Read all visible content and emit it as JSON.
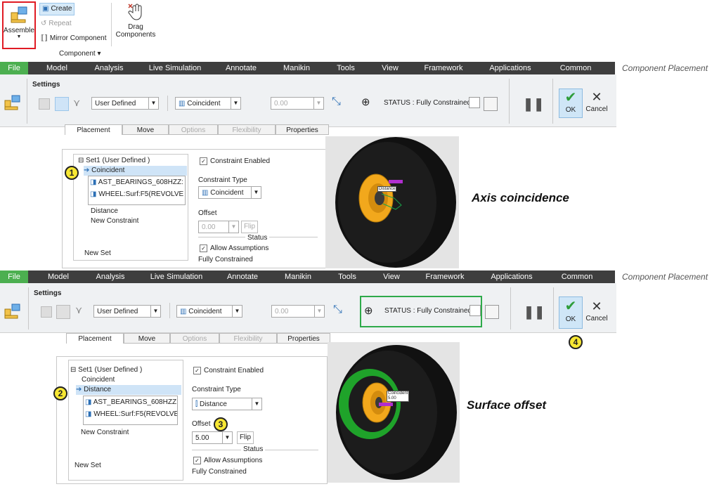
{
  "ribbon": {
    "assemble_label": "Assemble",
    "create_label": "Create",
    "repeat_label": "Repeat",
    "mirror_label": "Mirror Component",
    "drag_label_1": "Drag",
    "drag_label_2": "Components",
    "group_label": "Component ▾"
  },
  "menu": {
    "file": "File",
    "items": [
      "Model",
      "Analysis",
      "Live Simulation",
      "Annotate",
      "Manikin",
      "Tools",
      "View",
      "Framework",
      "Applications",
      "Common"
    ],
    "context_title": "Component Placement"
  },
  "toolbar": {
    "settings_label": "Settings",
    "set_type": "User Defined",
    "constraint": "Coincident",
    "offset_value": "0.00",
    "status_text": "STATUS : Fully Constrained",
    "ok_label": "OK",
    "cancel_label": "Cancel"
  },
  "tabs": [
    "Placement",
    "Move",
    "Options",
    "Flexibility",
    "Properties"
  ],
  "panel1": {
    "set_title": "Set1 (User Defined )",
    "constraint_selected": "Coincident",
    "ref1": "AST_BEARINGS_608HZZ:",
    "ref2": "WHEEL:Surf:F5(REVOLVE",
    "distance": "Distance",
    "new_constraint": "New Constraint",
    "new_set": "New Set",
    "constraint_enabled": "Constraint Enabled",
    "constraint_type_label": "Constraint Type",
    "constraint_type_value": "Coincident",
    "offset_label": "Offset",
    "offset_value": "0.00",
    "flip": "Flip",
    "status_label": "Status",
    "allow_assumptions": "Allow Assumptions",
    "fully_constrained": "Fully Constrained",
    "callout": "1",
    "caption": "Axis coincidence"
  },
  "panel2": {
    "set_title": "Set1 (User Defined )",
    "coincident": "Coincident",
    "constraint_selected": "Distance",
    "ref1": "AST_BEARINGS_608HZZ:",
    "ref2": "WHEEL:Surf:F5(REVOLVE",
    "new_constraint": "New Constraint",
    "new_set": "New Set",
    "constraint_enabled": "Constraint Enabled",
    "constraint_type_label": "Constraint Type",
    "constraint_type_value": "Distance",
    "offset_label": "Offset",
    "offset_value": "5.00",
    "flip": "Flip",
    "status_label": "Status",
    "allow_assumptions": "Allow Assumptions",
    "fully_constrained": "Fully Constrained",
    "callout2": "2",
    "callout3": "3",
    "callout4": "4",
    "caption": "Surface offset"
  },
  "viewport": {
    "tag1": "Distance",
    "tag2": "Coincident",
    "tag2b": "5.00"
  },
  "colors": {
    "file_tab": "#4caf50",
    "menu_bar": "#3e3e3e",
    "assemble_highlight": "#e01b24",
    "status_highlight": "#2eaa4a",
    "callout": "#f7e733",
    "bearing": "#f2a81c",
    "offset_surface": "#1fa32a",
    "tag": "#b02ed0"
  }
}
